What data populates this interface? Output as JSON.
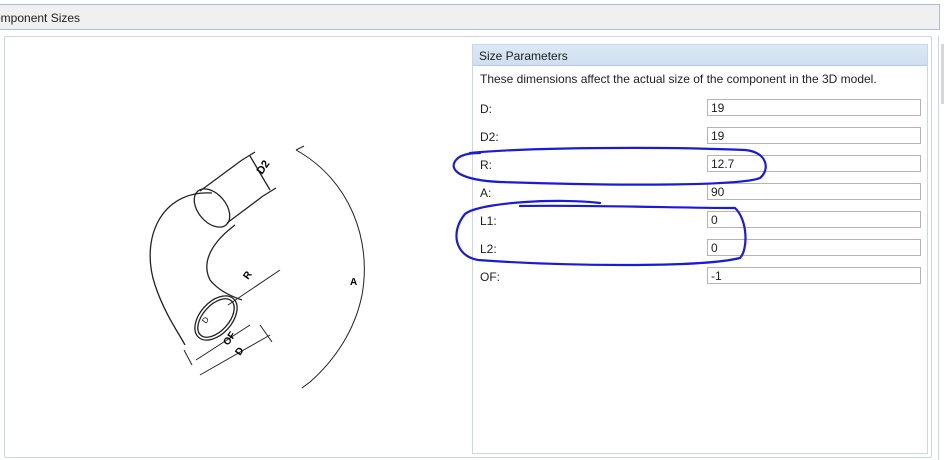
{
  "window": {
    "title": "omponent Sizes"
  },
  "panel": {
    "header": "Size Parameters",
    "description": "These dimensions affect the actual size of the component in the 3D model.",
    "params": [
      {
        "label": "D:",
        "value": "19"
      },
      {
        "label": "D2:",
        "value": "19"
      },
      {
        "label": "R:",
        "value": "12.7"
      },
      {
        "label": "A:",
        "value": "90"
      },
      {
        "label": "L1:",
        "value": "0"
      },
      {
        "label": "L2:",
        "value": "0"
      },
      {
        "label": "OF:",
        "value": "-1"
      }
    ]
  },
  "drawing": {
    "labels": {
      "d2": "D2",
      "r": "R",
      "a": "A",
      "d": "D",
      "of": "OF",
      "inner_d": "D"
    }
  },
  "annotations": {
    "ink_color": "#1a1adb"
  }
}
